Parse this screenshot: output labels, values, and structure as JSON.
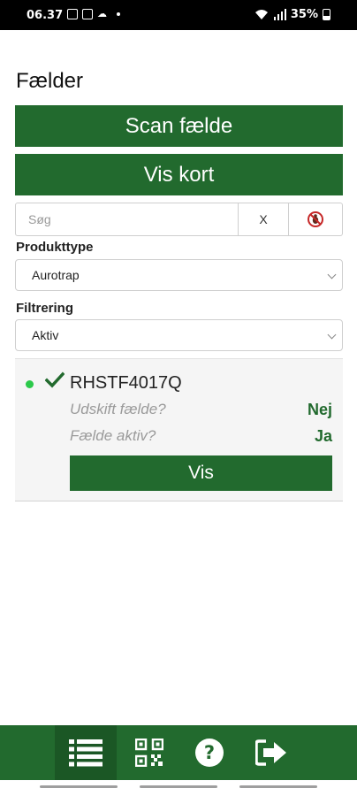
{
  "status_bar": {
    "time": "06.37",
    "battery": "35%"
  },
  "page": {
    "title": "Fælder"
  },
  "actions": {
    "scan_label": "Scan fælde",
    "map_label": "Vis kort"
  },
  "search": {
    "placeholder": "Søg",
    "value": "",
    "clear_label": "X",
    "extra_icon": "no-bug-icon"
  },
  "filters": {
    "product_type_label": "Produkttype",
    "product_type_value": "Aurotrap",
    "filter_label": "Filtrering",
    "filter_value": "Aktiv"
  },
  "traps": [
    {
      "id": "RHSTF4017Q",
      "status_color": "#2bc94a",
      "replace_label": "Udskift fælde?",
      "replace_value": "Nej",
      "active_label": "Fælde aktiv?",
      "active_value": "Ja",
      "view_label": "Vis"
    }
  ],
  "bottom_nav": {
    "items": [
      {
        "icon": "list-icon",
        "active": true
      },
      {
        "icon": "qr-code-icon",
        "active": false
      },
      {
        "icon": "help-icon",
        "active": false
      },
      {
        "icon": "logout-icon",
        "active": false
      }
    ]
  },
  "colors": {
    "primary": "#226a2e",
    "status_active": "#2bc94a"
  }
}
